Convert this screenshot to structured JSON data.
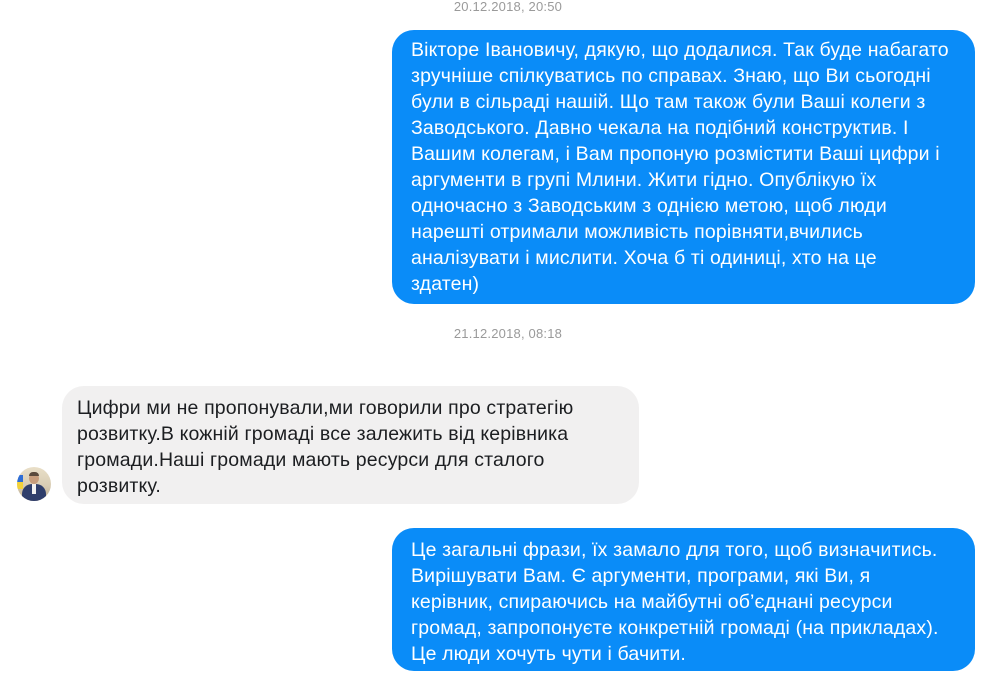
{
  "messages": [
    {
      "kind": "timestamp",
      "text": "20.12.2018, 20:50"
    },
    {
      "kind": "outgoing",
      "text": "Вікторе Івановичу, дякую, що додалися. Так буде набагато\nзручніше спілкуватись по справах. Знаю, що Ви сьогодні\nбули в сільраді нашій. Що там також були Ваші колеги з\nЗаводського. Давно чекала на подібний конструктив. І\nВашим колегам, і Вам пропоную розмістити Ваші цифри і\nаргументи в групі Млини. Жити гідно. Опублікую їх\nодночасно з Заводським  з однією метою, щоб люди\nнарешті отримали можливість  порівняти,вчились\nаналізувати і  мислити. Хоча б ті одиниці, хто на це\nздатен)"
    },
    {
      "kind": "timestamp",
      "text": "21.12.2018, 08:18"
    },
    {
      "kind": "incoming",
      "text": "Цифри ми не пропонували,ми говорили про стратегію\nрозвитку.В кожній громаді все залежить від керівника\nгромади.Наші громади мають ресурси для сталого\nрозвитку."
    },
    {
      "kind": "outgoing",
      "text": "Це загальні фрази, їх замало для того, щоб визначитись.\nВирішувати Вам. Є аргументи, програми, які Ви, я\nкерівник, спираючись на майбутні об’єднані ресурси\nгромад, запропонуєте конкретній громаді (на прикладах).\nЦе люди хочуть чути і бачити."
    }
  ],
  "colors": {
    "outgoing_bubble": "#0a8cf8",
    "incoming_bubble": "#f1f0f0",
    "timestamp_text": "#9a9a9a"
  },
  "icons": {
    "sender_avatar": "avatar"
  }
}
